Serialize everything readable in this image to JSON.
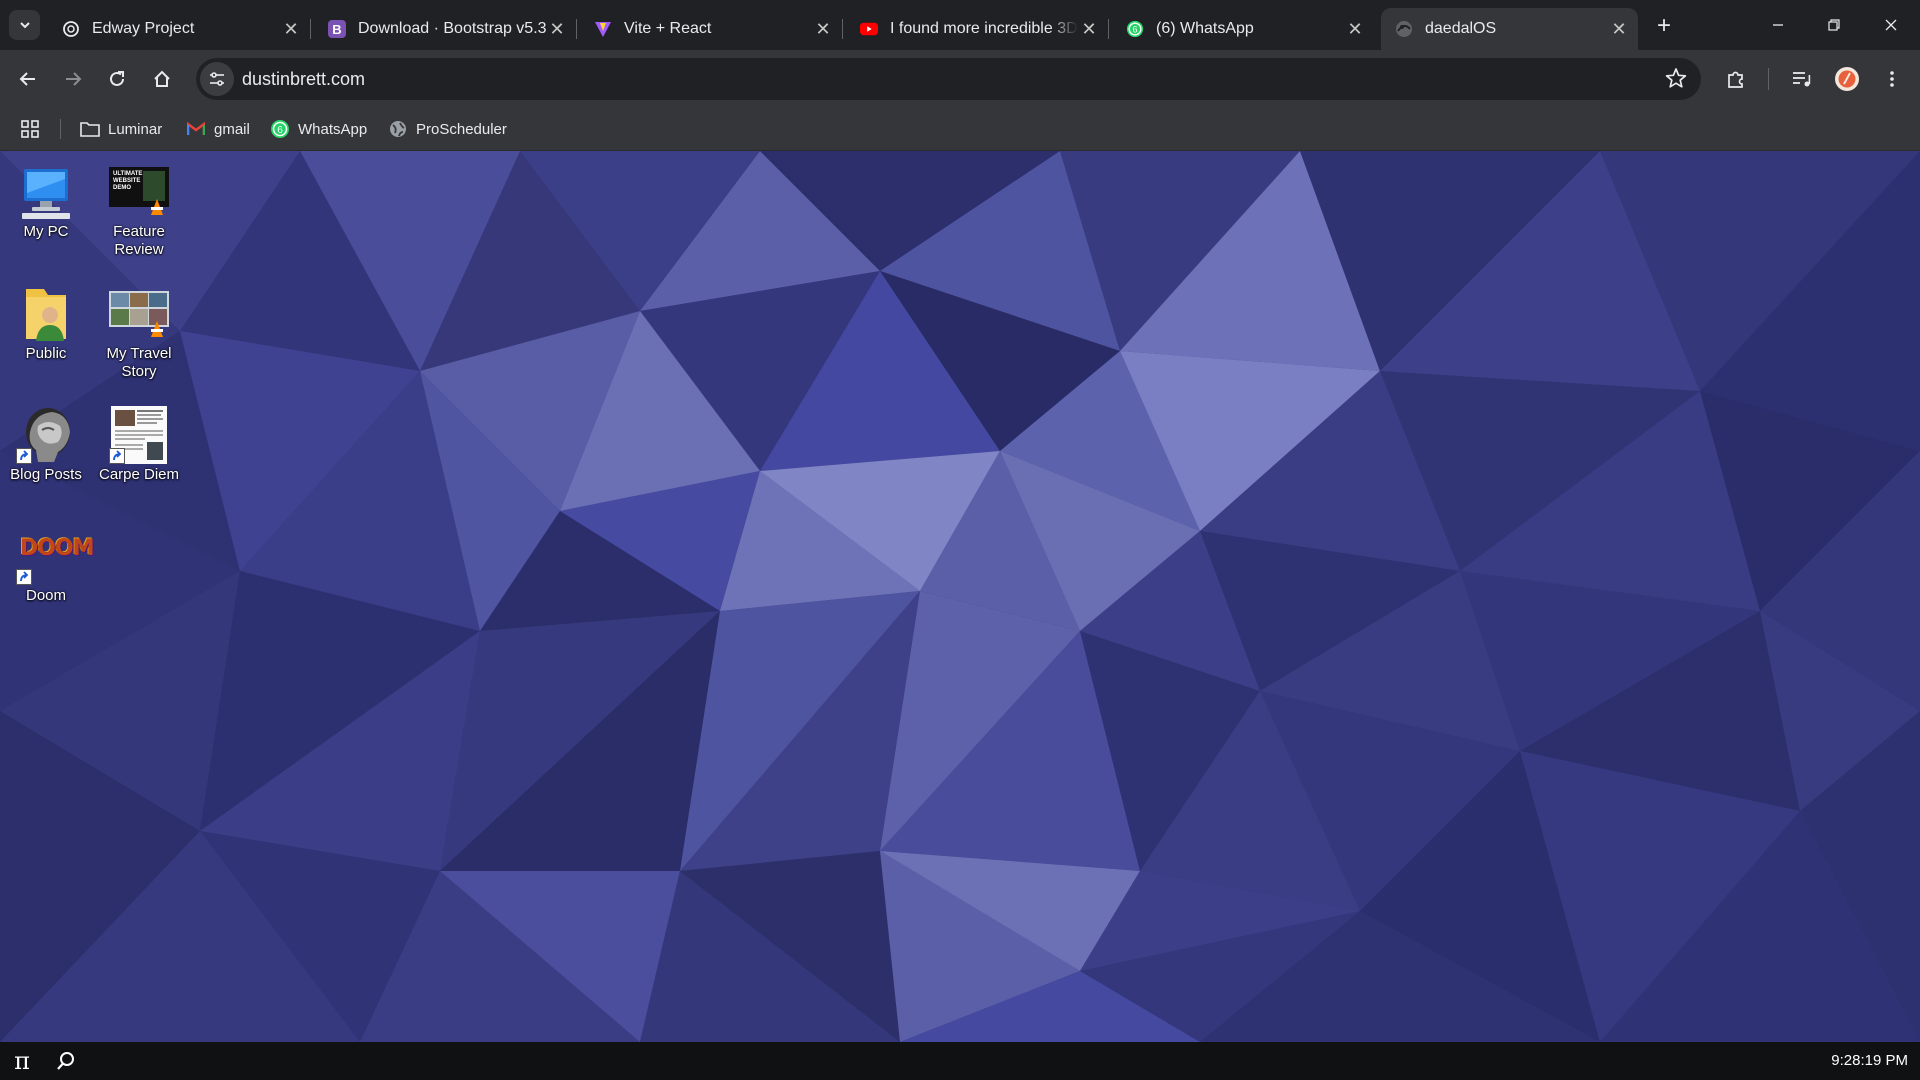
{
  "tabs": [
    {
      "title": "Edway Project",
      "favicon": "openai-icon"
    },
    {
      "title": "Download · Bootstrap v5.3",
      "favicon": "bootstrap-icon"
    },
    {
      "title": "Vite + React",
      "favicon": "vite-icon"
    },
    {
      "title": "I found more incredible 3D",
      "favicon": "youtube-icon"
    },
    {
      "title": "(6) WhatsApp",
      "favicon": "whatsapp-icon"
    },
    {
      "title": "daedalOS",
      "favicon": "daedalos-icon",
      "active": true
    }
  ],
  "address_bar": {
    "url": "dustinbrett.com"
  },
  "bookmarks": [
    {
      "label": "Luminar",
      "icon": "folder-icon"
    },
    {
      "label": "gmail",
      "icon": "gmail-icon"
    },
    {
      "label": "WhatsApp",
      "icon": "whatsapp-icon",
      "badge": "6"
    },
    {
      "label": "ProScheduler",
      "icon": "globe-icon"
    }
  ],
  "desktop_icons": [
    {
      "label": "My PC"
    },
    {
      "label": "Feature Review",
      "thumb_text": "ULTIMATE WEBSITE DEMO"
    },
    {
      "label": "Public"
    },
    {
      "label": "My Travel Story"
    },
    {
      "label": "Blog Posts"
    },
    {
      "label": "Carpe Diem"
    },
    {
      "label": "Doom",
      "thumb_text": "DOOM"
    }
  ],
  "taskbar": {
    "start_glyph": "π",
    "clock": "9:28:19 PM"
  },
  "colors": {
    "wallpaper_base": "#36387a",
    "chrome_dark": "#202124",
    "chrome_toolbar": "#35363a",
    "taskbar": "#101113"
  }
}
